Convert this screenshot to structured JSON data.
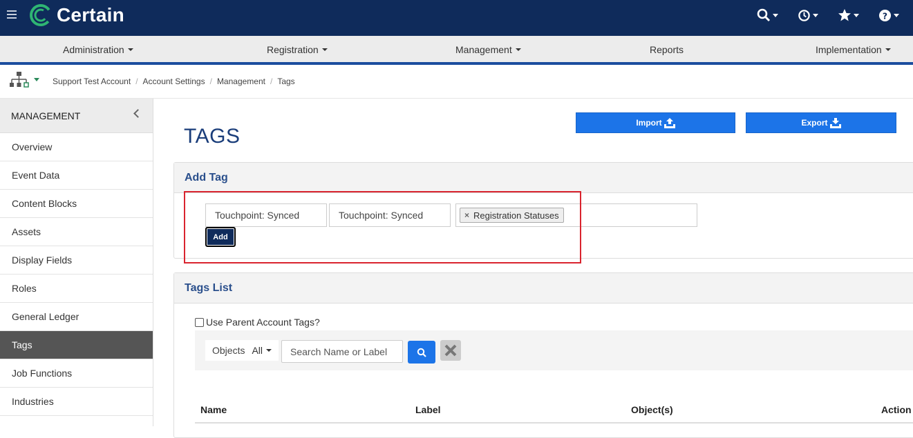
{
  "app": {
    "name": "Certain"
  },
  "topbar": {
    "icons": [
      "search-icon",
      "history-icon",
      "star-icon",
      "help-icon"
    ]
  },
  "nav": {
    "items": [
      {
        "label": "Administration",
        "dropdown": true
      },
      {
        "label": "Registration",
        "dropdown": true
      },
      {
        "label": "Management",
        "dropdown": true
      },
      {
        "label": "Reports",
        "dropdown": false
      },
      {
        "label": "Implementation",
        "dropdown": true
      }
    ]
  },
  "breadcrumb": [
    "Support Test Account",
    "Account Settings",
    "Management",
    "Tags"
  ],
  "sidebar": {
    "heading": "MANAGEMENT",
    "items": [
      {
        "label": "Overview"
      },
      {
        "label": "Event Data"
      },
      {
        "label": "Content Blocks"
      },
      {
        "label": "Assets"
      },
      {
        "label": "Display Fields"
      },
      {
        "label": "Roles"
      },
      {
        "label": "General Ledger"
      },
      {
        "label": "Tags",
        "active": true
      },
      {
        "label": "Job Functions"
      },
      {
        "label": "Industries"
      }
    ]
  },
  "page": {
    "title": "TAGS",
    "import_label": "Import",
    "export_label": "Export"
  },
  "add_tag": {
    "heading": "Add Tag",
    "name_value": "Touchpoint: Synced",
    "label_value": "Touchpoint: Synced",
    "selected_object": "Registration Statuses",
    "add_label": "Add"
  },
  "tags_list": {
    "heading": "Tags List",
    "use_parent_label": "Use Parent Account Tags?",
    "objects_label": "Objects",
    "objects_value": "All",
    "search_placeholder": "Search Name or Label",
    "columns": [
      "Name",
      "Label",
      "Object(s)",
      "Action"
    ]
  },
  "colors": {
    "topbar": "#0f2b5b",
    "accent_blue": "#1c74e8",
    "title_blue": "#1a3d7a",
    "highlight_red": "#d9232e",
    "logo_green": "#2fb573"
  }
}
